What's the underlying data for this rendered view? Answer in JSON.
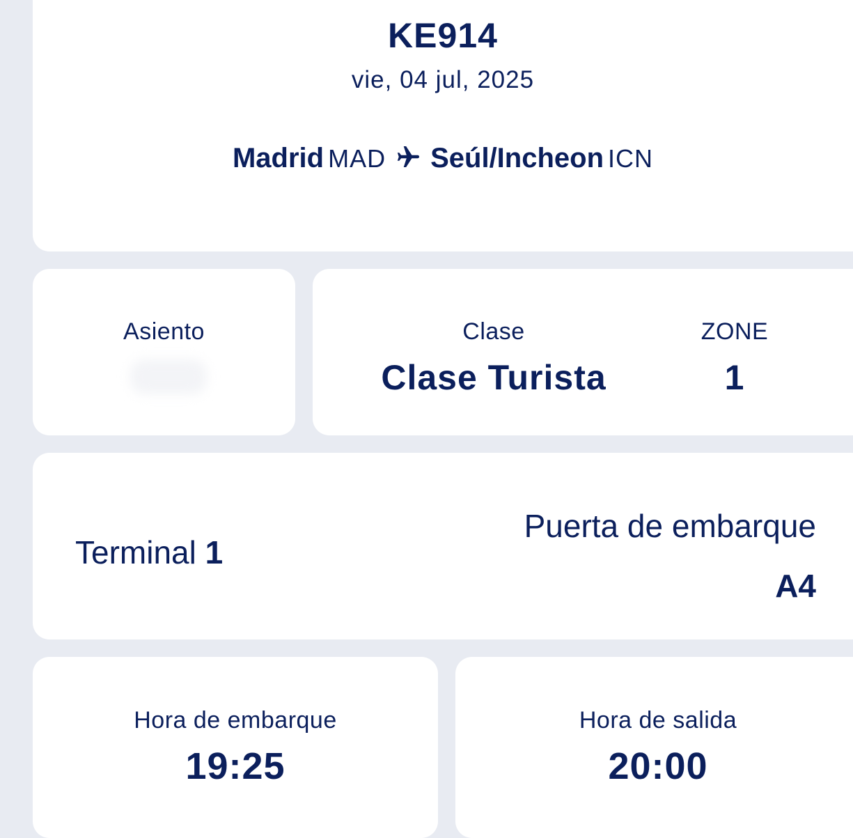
{
  "flight": {
    "number": "KE914",
    "date": "vie, 04 jul, 2025",
    "origin_city": "Madrid",
    "origin_code": "MAD",
    "destination_city": "Seúl/Incheon",
    "destination_code": "ICN",
    "route_icon": "airplane-icon"
  },
  "seat": {
    "label": "Asiento",
    "value": ""
  },
  "class_info": {
    "class_label": "Clase",
    "class_value": "Clase Turista",
    "zone_label": "ZONE",
    "zone_value": "1"
  },
  "terminal": {
    "label": "Terminal",
    "value": "1",
    "gate_label": "Puerta de embarque",
    "gate_value": "A4"
  },
  "times": {
    "boarding_label": "Hora de embarque",
    "boarding_value": "19:25",
    "departure_label": "Hora de salida",
    "departure_value": "20:00"
  },
  "colors": {
    "text": "#0b1f5c",
    "background": "#e8ebf2",
    "card": "#ffffff"
  }
}
